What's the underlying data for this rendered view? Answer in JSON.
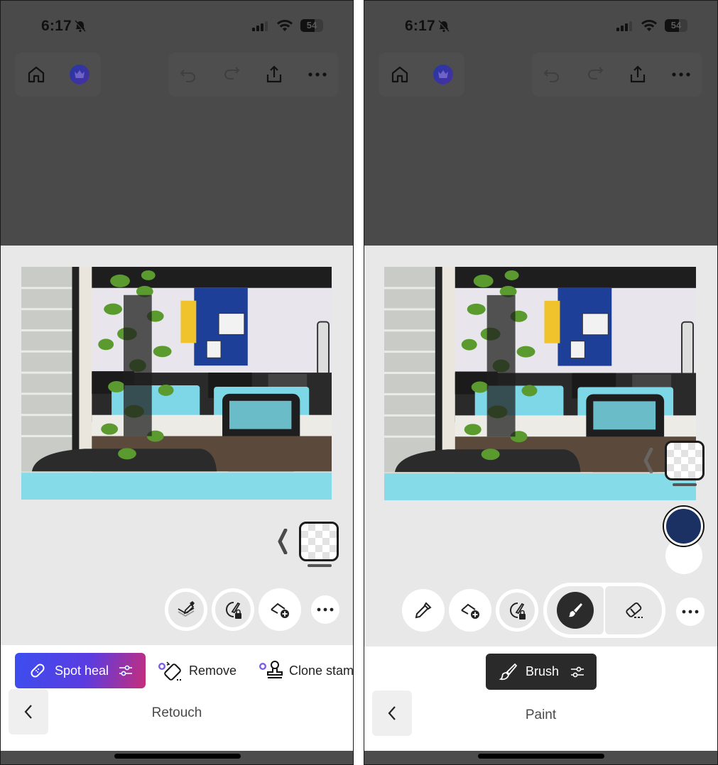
{
  "screens": [
    {
      "status_bar": {
        "time": "6:17",
        "battery": "54",
        "silent": true
      },
      "top_bar": {
        "left": [
          "home-icon",
          "premium-crown-icon"
        ],
        "right": [
          "undo-icon",
          "redo-icon",
          "share-icon",
          "more-icon"
        ]
      },
      "canvas": {
        "image_description": "Office interior with a hanging pothos plant, blue acoustic wall panels, desks with cyan partitions and mesh chairs",
        "layer_thumbnail": "transparent-layer"
      },
      "tool_row": [
        "layer-sample-icon",
        "locked-mask-brush-icon",
        "add-selection-icon",
        "more-icon"
      ],
      "tools": [
        {
          "label": "Spot heal",
          "icon": "bandage-icon",
          "active": true,
          "premium": false
        },
        {
          "label": "Remove",
          "icon": "eraser-sparkle-icon",
          "active": false,
          "premium": true
        },
        {
          "label": "Clone stamp",
          "icon": "stamp-icon",
          "active": false,
          "premium": true
        }
      ],
      "panel_title": "Retouch",
      "colors": {
        "active_gradient_start": "#3b4ef0",
        "active_gradient_end": "#c72d7a"
      }
    },
    {
      "status_bar": {
        "time": "6:17",
        "battery": "54",
        "silent": true
      },
      "top_bar": {
        "left": [
          "home-icon",
          "premium-crown-icon"
        ],
        "right": [
          "undo-icon",
          "redo-icon",
          "share-icon",
          "more-icon"
        ]
      },
      "canvas": {
        "image_description": "Office interior with a hanging pothos plant, blue acoustic wall panels, desks with cyan partitions and mesh chairs",
        "layer_thumbnail": "transparent-layer"
      },
      "tool_row": [
        "eyedropper-icon",
        "add-selection-icon",
        "locked-mask-brush-icon",
        "brush-icon",
        "eraser-icon",
        "more-icon"
      ],
      "paint_mode": {
        "selected": "brush",
        "options": [
          "brush",
          "eraser"
        ]
      },
      "colors": {
        "primary": "#1c3163",
        "secondary": "#ffffff"
      },
      "active_tool": {
        "label": "Brush",
        "icon": "brush-icon"
      },
      "panel_title": "Paint"
    }
  ]
}
